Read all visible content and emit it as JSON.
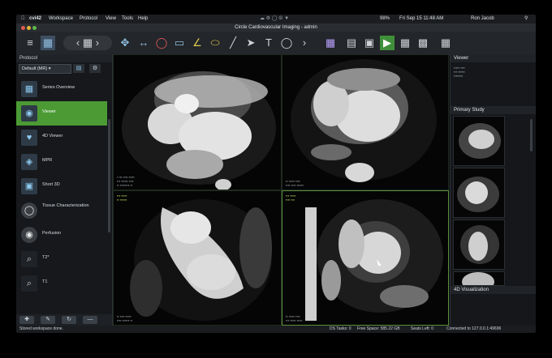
{
  "menubar": {
    "app": "cvi42",
    "menus": [
      "Workspace",
      "Protocol",
      "View",
      "Tools",
      "Help"
    ],
    "battery": "98%",
    "clock": "Fri Sep 15 11:48 AM",
    "user": "Ron Jacob"
  },
  "window": {
    "title": "Circle Cardiovascular Imaging - admin"
  },
  "left_panel": {
    "header": "Protocol",
    "protocol_select": "Default (MR) ▾",
    "steps": [
      {
        "label": "Series Overview",
        "icon": "series-overview-icon"
      },
      {
        "label": "Viewer",
        "icon": "viewer-icon"
      },
      {
        "label": "4D Viewer",
        "icon": "4d-viewer-icon"
      },
      {
        "label": "MPR",
        "icon": "mpr-icon"
      },
      {
        "label": "Short 3D",
        "icon": "short-3d-icon"
      },
      {
        "label": "Tissue Characterization",
        "icon": "tissue-icon"
      },
      {
        "label": "Perfusion",
        "icon": "perfusion-icon"
      },
      {
        "label": "T2*",
        "icon": "t2star-icon"
      },
      {
        "label": "T1",
        "icon": "t1-icon"
      }
    ]
  },
  "right_panel": {
    "viewer_header": "Viewer",
    "primary_study_header": "Primary Study",
    "visualization_header": "4D Visualization"
  },
  "status": {
    "left": "Stored workspace done.",
    "ds_tasks": "DS Tasks: 0",
    "free_space": "Free Space: 585.22 GB",
    "seats_left": "Seats Left: 0",
    "connected": "Connected to 127.0.0.1:49696"
  },
  "colors": {
    "accent": "#4b9a34",
    "annotation": "#b6d65a"
  }
}
